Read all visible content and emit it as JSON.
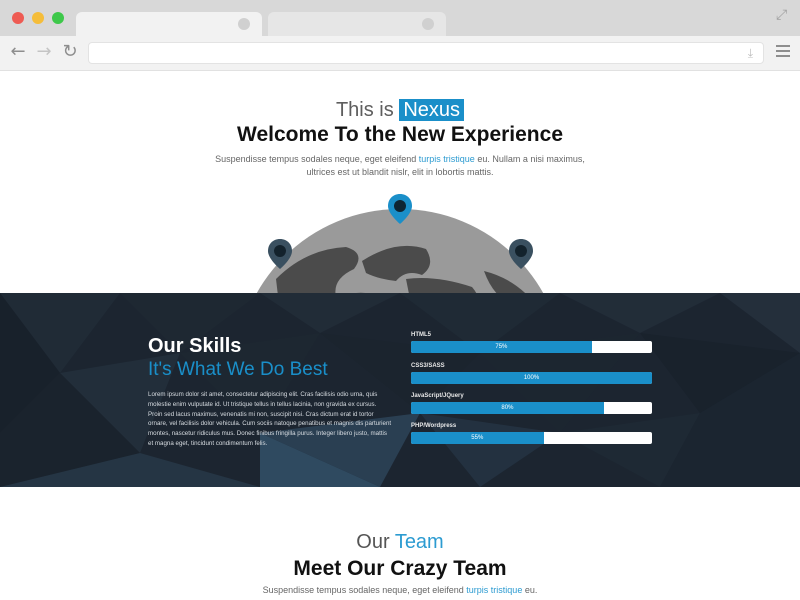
{
  "hero": {
    "pretitle_prefix": "This is",
    "pretitle_brand": "Nexus",
    "title": "Welcome To the New Experience",
    "text_before": "Suspendisse tempus sodales neque, eget eleifend ",
    "text_link": "turpis tristique",
    "text_after": " eu. Nullam a nisi maximus, ultrices est ut blandit nislr, elit in lobortis mattis."
  },
  "skills": {
    "title": "Our Skills",
    "subtitle": "It's What We Do Best",
    "text": "Lorem ipsum dolor sit amet, consectetur adipiscing elit. Cras facilisis odio urna, quis molestie enim vulputate id. Ut tristique tellus in tellus lacinia, non gravida ex cursus. Proin sed lacus maximus, venenatis mi non, suscipit nisi. Cras dictum erat id tortor ornare, vel facilisis dolor vehicula. Cum sociis natoque penatibus et magnis dis parturient montes, nascetur ridiculus mus. Donec finibus fringilla purus. Integer libero justo, mattis et magna eget, tincidunt condimentum felis.",
    "items": [
      {
        "label": "HTML5",
        "percent": 75,
        "percent_label": "75%"
      },
      {
        "label": "CSS3/SASS",
        "percent": 100,
        "percent_label": "100%"
      },
      {
        "label": "JavaScript/JQuery",
        "percent": 80,
        "percent_label": "80%"
      },
      {
        "label": "PHP/Wordpress",
        "percent": 55,
        "percent_label": "55%"
      }
    ]
  },
  "team": {
    "pretitle_prefix": "Our",
    "pretitle_accent": "Team",
    "title": "Meet Our Crazy Team",
    "text_before": "Suspendisse tempus sodales neque, eget eleifend ",
    "text_link": "turpis tristique",
    "text_after": " eu."
  },
  "colors": {
    "accent": "#1a8fc9",
    "skills_bg": "#1c2530",
    "globe": "#9a9a9a",
    "pin": "#1a8fc9"
  }
}
